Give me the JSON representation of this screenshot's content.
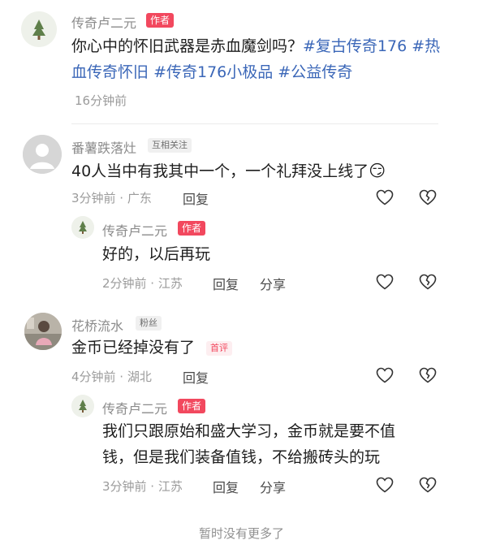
{
  "post": {
    "author": "传奇卢二元",
    "author_badge": "作者",
    "text_main": "你心中的怀旧武器是赤血魔剑吗？",
    "tag1": "#复古传奇176",
    "tag2": "#热血传奇怀旧",
    "tag3": "#传奇176小极品",
    "tag4": "#公益传奇",
    "time": "16分钟前"
  },
  "comments": [
    {
      "user": "番薯跌落灶",
      "relation_badge": "互相关注",
      "text": "40人当中有我其中一个，一个礼拜没上线了",
      "emoji": "😏",
      "meta": "3分钟前 · 广东",
      "reply_label": "回复",
      "reply": {
        "user": "传奇卢二元",
        "badge": "作者",
        "text": "好的，以后再玩",
        "meta": "2分钟前 · 江苏",
        "reply_label": "回复",
        "share_label": "分享"
      }
    },
    {
      "user": "花桥流水",
      "relation_badge": "粉丝",
      "text": "金币已经掉没有了",
      "first_badge": "首评",
      "meta": "4分钟前 · 湖北",
      "reply_label": "回复",
      "reply": {
        "user": "传奇卢二元",
        "badge": "作者",
        "text_line1": "我们只跟原始和盛大学习，金币就是要不值",
        "text_line2": "钱，但是我们装备值钱，不给搬砖头的玩",
        "meta": "3分钟前 · 江苏",
        "reply_label": "回复",
        "share_label": "分享"
      }
    }
  ],
  "footer": "暂时没有更多了",
  "icons": [
    "tree-avatar-icon",
    "heart-icon",
    "broken-heart-icon"
  ]
}
